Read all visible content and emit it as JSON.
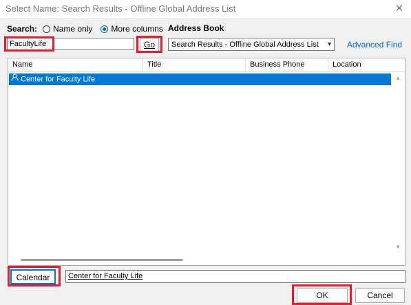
{
  "window": {
    "title": "Select Name: Search Results - Offline Global Address List",
    "close_label": "✕"
  },
  "search": {
    "label": "Search:",
    "option_name_only": "Name only",
    "option_more_columns": "More columns",
    "selected_option": "More columns",
    "query_value": "FacultyLife",
    "go_label": "Go"
  },
  "address_book": {
    "label": "Address Book",
    "selected": "Search Results - Offline Global Address List",
    "advanced_find": "Advanced Find"
  },
  "results": {
    "columns": [
      "Name",
      "Title",
      "Business Phone",
      "Location"
    ],
    "rows": [
      {
        "name": "Center for Faculty Life",
        "selected": true
      }
    ]
  },
  "footer": {
    "calendar_label": "Calendar",
    "recipient_value": "Center for Faculty Life",
    "ok_label": "OK",
    "cancel_label": "Cancel"
  },
  "colors": {
    "highlight_box": "#e02030",
    "selection": "#0078d7",
    "link": "#0066cc"
  }
}
